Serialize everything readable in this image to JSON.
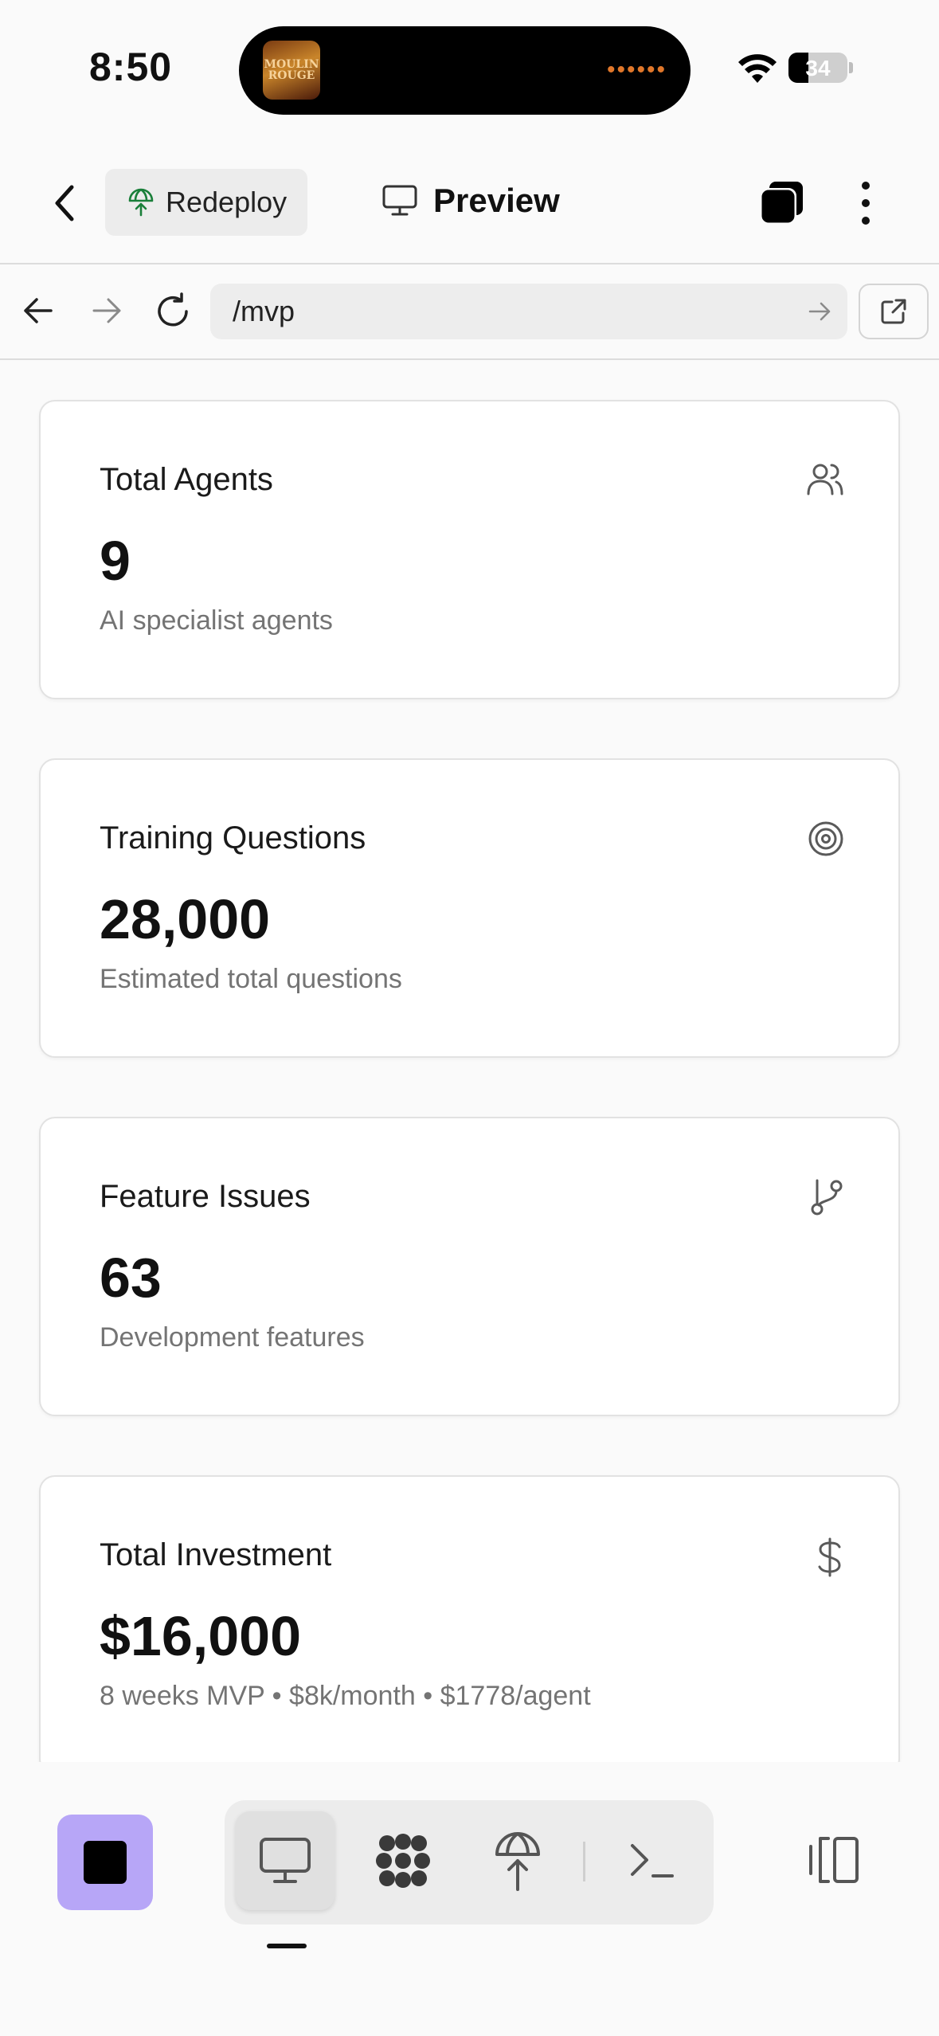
{
  "status_bar": {
    "time": "8:50",
    "battery": "34",
    "battery_level": 0.34,
    "island_art_text": "MOULIN ROUGE",
    "island_dots": "••••••"
  },
  "toolbar": {
    "redeploy_label": "Redeploy",
    "preview_label": "Preview"
  },
  "browser": {
    "url": "/mvp"
  },
  "cards": [
    {
      "title": "Total Agents",
      "value": "9",
      "subtitle": "AI specialist agents",
      "icon": "users-icon"
    },
    {
      "title": "Training Questions",
      "value": "28,000",
      "subtitle": "Estimated total questions",
      "icon": "target-icon"
    },
    {
      "title": "Feature Issues",
      "value": "63",
      "subtitle": "Development features",
      "icon": "git-branch-icon"
    },
    {
      "title": "Total Investment",
      "value": "$16,000",
      "subtitle": "8 weeks MVP • $8k/month • $1778/agent",
      "icon": "dollar-icon"
    }
  ],
  "bottom_bar": {
    "icons": [
      "stop-icon",
      "monitor-icon",
      "workspace-icon",
      "deploy-icon",
      "terminal-icon",
      "panel-icon"
    ],
    "colors": {
      "stop_button_bg": "#b7a6f7"
    }
  }
}
